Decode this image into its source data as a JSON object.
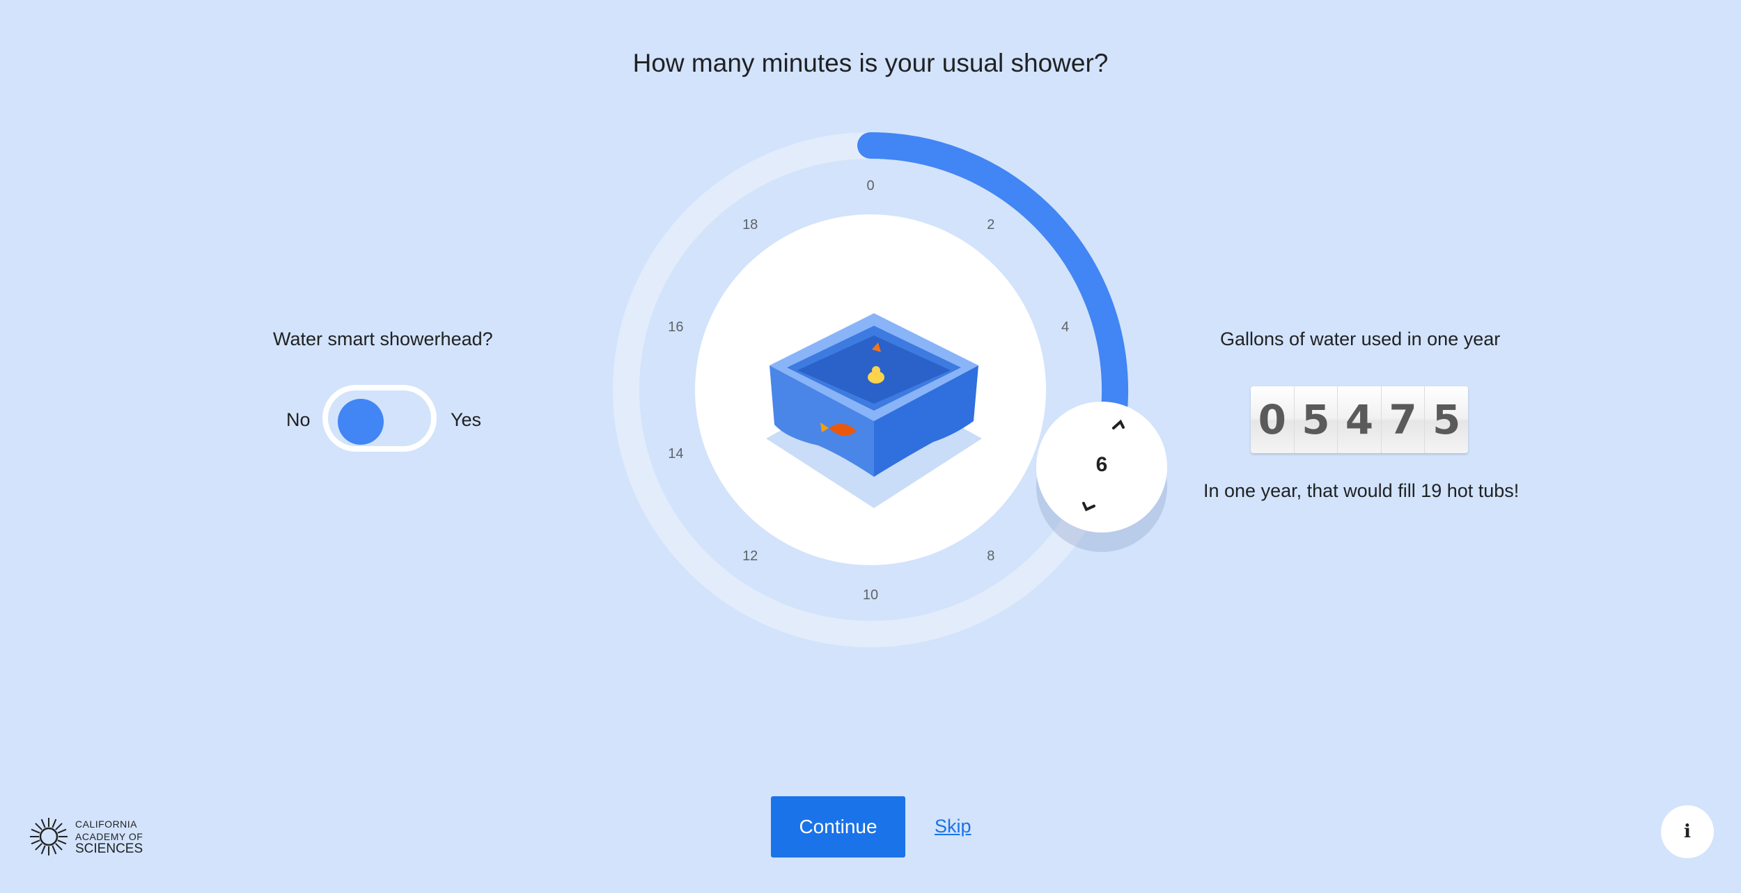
{
  "question": "How many minutes is your usual shower?",
  "showerhead": {
    "title": "Water smart showerhead?",
    "no_label": "No",
    "yes_label": "Yes",
    "enabled": false
  },
  "dial": {
    "tick_labels": [
      "0",
      "2",
      "4",
      "8",
      "10",
      "12",
      "14",
      "16",
      "18"
    ],
    "value": "6",
    "min": 0,
    "max": 20,
    "progress_color": "#4285f4",
    "track_color": "#e3ecfb"
  },
  "gallons": {
    "title": "Gallons of water used in one year",
    "digits": [
      "0",
      "5",
      "4",
      "7",
      "5"
    ],
    "summary": "In one year, that would fill 19 hot tubs!"
  },
  "footer": {
    "continue_label": "Continue",
    "skip_label": "Skip",
    "info_label": "i",
    "logo_line1": "CALIFORNIA",
    "logo_line2": "ACADEMY OF",
    "logo_line3": "SCIENCES"
  },
  "icons": {
    "info": "info-icon",
    "logo": "sunburst-logo-icon",
    "knob_up": "chevron-up-icon",
    "knob_down": "chevron-down-icon"
  }
}
